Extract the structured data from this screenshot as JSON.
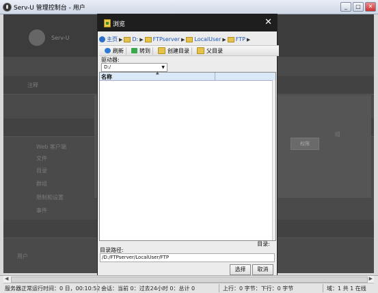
{
  "window": {
    "title": "Serv-U 管理控制台 - 用户",
    "min": "_",
    "max": "□",
    "close": "✕"
  },
  "background": {
    "brand": "Serv-U",
    "rows": [
      "注释",
      "",
      "",
      ""
    ],
    "side_items": [
      "Web 客户端",
      "文件",
      "目录",
      "群组",
      "限制和设置",
      "事件",
      "用户"
    ],
    "button": "权限",
    "hint": "组"
  },
  "dialog": {
    "title": "浏览",
    "close": "✕",
    "breadcrumb": [
      "主页",
      "D:",
      "FTPserver",
      "LocalUser",
      "FTP"
    ],
    "toolbar": [
      "刷新",
      "转到",
      "创建目录",
      "父目录"
    ],
    "drive_label": "驱动器:",
    "drive_value": "D:/",
    "columns": [
      "名称",
      ""
    ],
    "dir_label_right": "目录:",
    "path_label": "目录路径:",
    "path_value": "/D:/FTPserver/LocalUser/FTP",
    "ok": "选择",
    "cancel": "取消"
  },
  "status": {
    "uptime": "服务器正常运行时间：0 日，00:10:52",
    "sessions": "会话：当前 0：过去24小时 0：总计 0",
    "upload": "上行：0 字节：下行：0 字节",
    "domain": "域：1 共 1 在线"
  }
}
